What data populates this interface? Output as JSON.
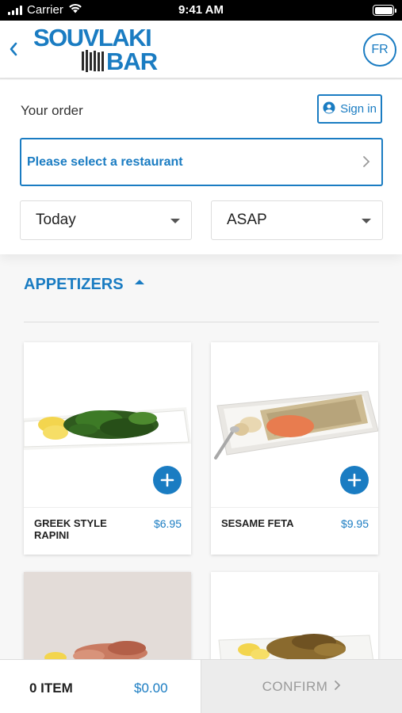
{
  "status_bar": {
    "carrier": "Carrier",
    "time": "9:41 AM"
  },
  "header": {
    "logo_top": "SOUVLAKI",
    "logo_bottom": "BAR",
    "language": "FR"
  },
  "order": {
    "title": "Your order",
    "sign_in": "Sign in",
    "restaurant_placeholder": "Please select a restaurant",
    "day": "Today",
    "time": "ASAP"
  },
  "menu": {
    "category": "APPETIZERS",
    "products": [
      {
        "name": "GREEK STYLE RAPINI",
        "price": "$6.95"
      },
      {
        "name": "SESAME FETA",
        "price": "$9.95"
      },
      {
        "name": "",
        "price": ""
      },
      {
        "name": "",
        "price": ""
      }
    ]
  },
  "cart": {
    "items": "0 ITEM",
    "total": "$0.00",
    "confirm": "CONFIRM"
  },
  "colors": {
    "accent": "#1a7cc2"
  },
  "icons": [
    "wifi-icon",
    "battery-icon",
    "back-chevron-icon",
    "user-circle-icon",
    "chevron-right-icon",
    "caret-down-icon",
    "caret-up-icon",
    "plus-icon"
  ]
}
